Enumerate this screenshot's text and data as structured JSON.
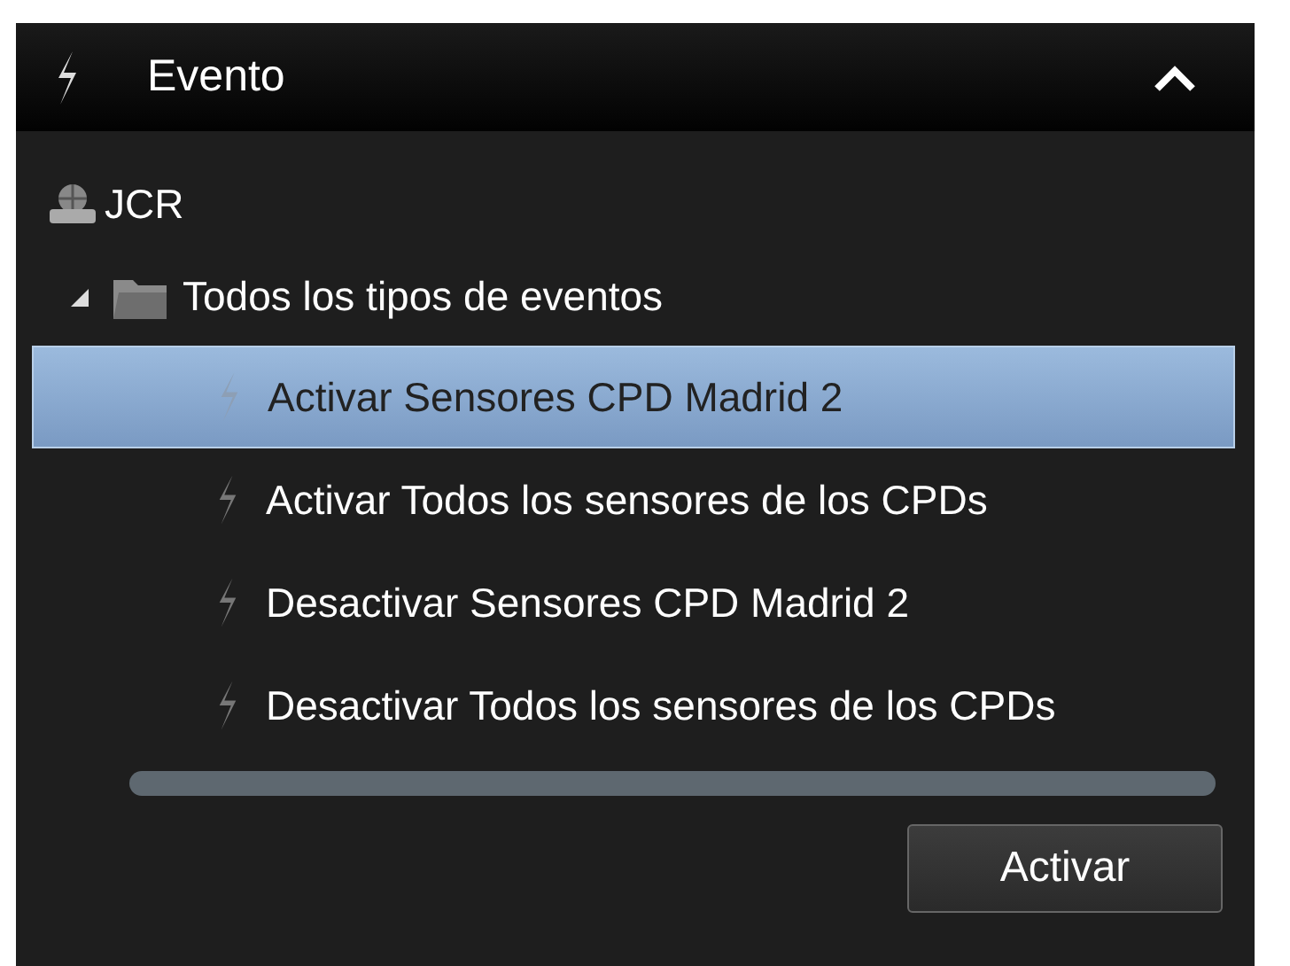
{
  "header": {
    "title": "Evento",
    "expanded": true
  },
  "tree": [
    {
      "label": "JCR",
      "kind": "server",
      "children": [
        {
          "label": "Todos los tipos de eventos",
          "kind": "folder",
          "expanded": true,
          "children": [
            {
              "label": "Activar Sensores CPD Madrid 2",
              "kind": "event",
              "selected": true
            },
            {
              "label": "Activar Todos los sensores de los CPDs",
              "kind": "event",
              "selected": false
            },
            {
              "label": "Desactivar Sensores CPD Madrid 2",
              "kind": "event",
              "selected": false
            },
            {
              "label": "Desactivar Todos los sensores de los CPDs",
              "kind": "event",
              "selected": false
            }
          ]
        }
      ]
    }
  ],
  "button": "Activar"
}
